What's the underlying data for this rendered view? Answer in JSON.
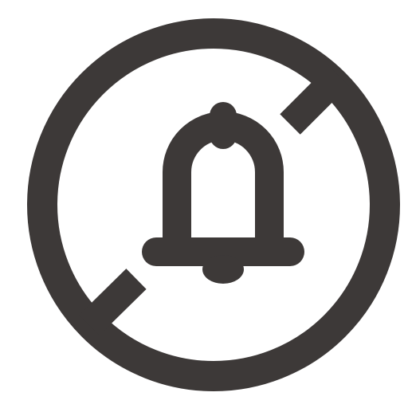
{
  "icon": {
    "name": "notifications-off-icon",
    "color": "#3d3938",
    "background": "#ffffff"
  }
}
